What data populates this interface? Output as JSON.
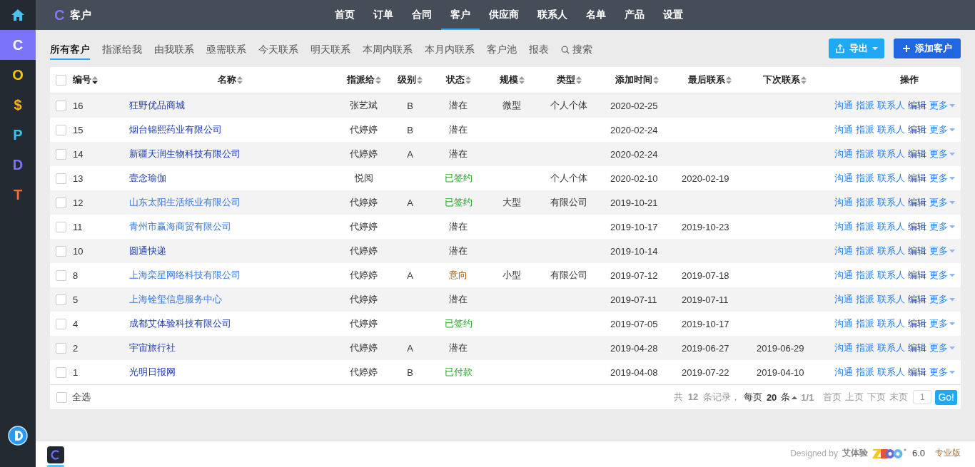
{
  "sidebar": {
    "items": [
      {
        "label": "C",
        "selected": true
      },
      {
        "label": "O",
        "selected": false
      },
      {
        "label": "$",
        "selected": false
      },
      {
        "label": "P",
        "selected": false
      },
      {
        "label": "D",
        "selected": false
      },
      {
        "label": "T",
        "selected": false
      }
    ]
  },
  "header": {
    "app_letter": "C",
    "title": "客户",
    "nav": [
      {
        "label": "首页",
        "selected": false
      },
      {
        "label": "订单",
        "selected": false
      },
      {
        "label": "合同",
        "selected": false
      },
      {
        "label": "客户",
        "selected": true
      },
      {
        "label": "供应商",
        "selected": false
      },
      {
        "label": "联系人",
        "selected": false
      },
      {
        "label": "名单",
        "selected": false
      },
      {
        "label": "产品",
        "selected": false
      },
      {
        "label": "设置",
        "selected": false
      }
    ]
  },
  "subnav": {
    "tabs": [
      {
        "label": "所有客户",
        "selected": true
      },
      {
        "label": "指派给我",
        "selected": false
      },
      {
        "label": "由我联系",
        "selected": false
      },
      {
        "label": "亟需联系",
        "selected": false
      },
      {
        "label": "今天联系",
        "selected": false
      },
      {
        "label": "明天联系",
        "selected": false
      },
      {
        "label": "本周内联系",
        "selected": false
      },
      {
        "label": "本月内联系",
        "selected": false
      },
      {
        "label": "客户池",
        "selected": false
      },
      {
        "label": "报表",
        "selected": false
      }
    ],
    "search": "搜索",
    "export_button": "导出",
    "add_button": "添加客户"
  },
  "table": {
    "header_checked": false,
    "columns": [
      {
        "label": "编号",
        "kind": "sortable",
        "sorted": true
      },
      {
        "label": "名称",
        "kind": "sortable",
        "sorted": false
      },
      {
        "label": "指派给",
        "kind": "sortable",
        "sorted": false
      },
      {
        "label": "级别",
        "kind": "sortable",
        "sorted": false
      },
      {
        "label": "状态",
        "kind": "sortable",
        "sorted": false
      },
      {
        "label": "规模",
        "kind": "sortable",
        "sorted": false
      },
      {
        "label": "类型",
        "kind": "sortable",
        "sorted": false
      },
      {
        "label": "添加时间",
        "kind": "sortable",
        "sorted": false
      },
      {
        "label": "最后联系",
        "kind": "sortable",
        "sorted": false
      },
      {
        "label": "下次联系",
        "kind": "sortable",
        "sorted": false
      },
      {
        "label": "操作",
        "kind": "plain"
      }
    ],
    "rows": [
      {
        "checked": false,
        "id": "16",
        "name": "狂野优品商城",
        "visited": true,
        "assigned": "张艺斌",
        "level": "B",
        "status": {
          "text": "潜在",
          "kind": "potential"
        },
        "scale": "微型",
        "type": "个人个体",
        "added": "2020-02-25",
        "last": "",
        "next": "",
        "actions": [
          "沟通",
          "指派",
          "联系人",
          "编辑",
          "更多"
        ]
      },
      {
        "checked": false,
        "id": "15",
        "name": "烟台锦熙药业有限公司",
        "visited": true,
        "assigned": "代婷婷",
        "level": "B",
        "status": {
          "text": "潜在",
          "kind": "potential"
        },
        "scale": "",
        "type": "",
        "added": "2020-02-24",
        "last": "",
        "next": "",
        "actions": [
          "沟通",
          "指派",
          "联系人",
          "编辑",
          "更多"
        ]
      },
      {
        "checked": false,
        "id": "14",
        "name": "新疆天润生物科技有限公司",
        "visited": true,
        "assigned": "代婷婷",
        "level": "A",
        "status": {
          "text": "潜在",
          "kind": "potential"
        },
        "scale": "",
        "type": "",
        "added": "2020-02-24",
        "last": "",
        "next": "",
        "actions": [
          "沟通",
          "指派",
          "联系人",
          "编辑",
          "更多"
        ]
      },
      {
        "checked": false,
        "id": "13",
        "name": "壹念瑜伽",
        "visited": true,
        "assigned": "悦阅",
        "level": "",
        "status": {
          "text": "已签约",
          "kind": "signed"
        },
        "scale": "",
        "type": "个人个体",
        "added": "2020-02-10",
        "last": "2020-02-19",
        "next": "",
        "actions": [
          "沟通",
          "指派",
          "联系人",
          "编辑",
          "更多"
        ]
      },
      {
        "checked": false,
        "id": "12",
        "name": "山东太阳生活纸业有限公司",
        "visited": false,
        "assigned": "代婷婷",
        "level": "A",
        "status": {
          "text": "已签约",
          "kind": "signed"
        },
        "scale": "大型",
        "type": "有限公司",
        "added": "2019-10-21",
        "last": "",
        "next": "",
        "actions": [
          "沟通",
          "指派",
          "联系人",
          "编辑",
          "更多"
        ]
      },
      {
        "checked": false,
        "id": "11",
        "name": "青州市赢海商贸有限公司",
        "visited": false,
        "assigned": "代婷婷",
        "level": "",
        "status": {
          "text": "潜在",
          "kind": "potential"
        },
        "scale": "",
        "type": "",
        "added": "2019-10-17",
        "last": "2019-10-23",
        "next": "",
        "actions": [
          "沟通",
          "指派",
          "联系人",
          "编辑",
          "更多"
        ]
      },
      {
        "checked": false,
        "id": "10",
        "name": "圆通快递",
        "visited": true,
        "assigned": "代婷婷",
        "level": "",
        "status": {
          "text": "潜在",
          "kind": "potential"
        },
        "scale": "",
        "type": "",
        "added": "2019-10-14",
        "last": "",
        "next": "",
        "actions": [
          "沟通",
          "指派",
          "联系人",
          "编辑",
          "更多"
        ]
      },
      {
        "checked": false,
        "id": "8",
        "name": "上海栾星网络科技有限公司",
        "visited": false,
        "assigned": "代婷婷",
        "level": "A",
        "status": {
          "text": "意向",
          "kind": "intent"
        },
        "scale": "小型",
        "type": "有限公司",
        "added": "2019-07-12",
        "last": "2019-07-18",
        "next": "",
        "actions": [
          "沟通",
          "指派",
          "联系人",
          "编辑",
          "更多"
        ]
      },
      {
        "checked": false,
        "id": "5",
        "name": "上海铨玺信息服务中心",
        "visited": false,
        "assigned": "代婷婷",
        "level": "",
        "status": {
          "text": "潜在",
          "kind": "potential"
        },
        "scale": "",
        "type": "",
        "added": "2019-07-11",
        "last": "2019-07-11",
        "next": "",
        "actions": [
          "沟通",
          "指派",
          "联系人",
          "编辑",
          "更多"
        ]
      },
      {
        "checked": false,
        "id": "4",
        "name": "成都艾体验科技有限公司",
        "visited": true,
        "assigned": "代婷婷",
        "level": "",
        "status": {
          "text": "已签约",
          "kind": "signed"
        },
        "scale": "",
        "type": "",
        "added": "2019-07-05",
        "last": "2019-10-17",
        "next": "",
        "actions": [
          "沟通",
          "指派",
          "联系人",
          "编辑",
          "更多"
        ]
      },
      {
        "checked": false,
        "id": "2",
        "name": "宇宙旅行社",
        "visited": true,
        "assigned": "代婷婷",
        "level": "A",
        "status": {
          "text": "潜在",
          "kind": "potential"
        },
        "scale": "",
        "type": "",
        "added": "2019-04-28",
        "last": "2019-06-27",
        "next": "2019-06-29",
        "actions": [
          "沟通",
          "指派",
          "联系人",
          "编辑",
          "更多"
        ]
      },
      {
        "checked": false,
        "id": "1",
        "name": "光明日报网",
        "visited": true,
        "assigned": "代婷婷",
        "level": "B",
        "status": {
          "text": "已付款",
          "kind": "paid"
        },
        "scale": "",
        "type": "",
        "added": "2019-04-08",
        "last": "2019-07-22",
        "next": "2019-04-10",
        "actions": [
          "沟通",
          "指派",
          "联系人",
          "编辑",
          "更多"
        ]
      }
    ],
    "footer": {
      "select_all": "全选",
      "select_all_checked": false,
      "total": "共 **12** 条记录，",
      "per_page": "每页 **20** 条",
      "page": "1/1",
      "pager_links": [
        {
          "label": "首页",
          "disabled": true
        },
        {
          "label": "上页",
          "disabled": true
        },
        {
          "label": "下页",
          "disabled": true
        },
        {
          "label": "末页",
          "disabled": true
        }
      ],
      "page_input": "1",
      "go_button": "Go!"
    }
  },
  "bottom_bar": {
    "designed_by": "Designed by",
    "designer": "艾体验",
    "version": "6.0",
    "edition": "专业版"
  }
}
